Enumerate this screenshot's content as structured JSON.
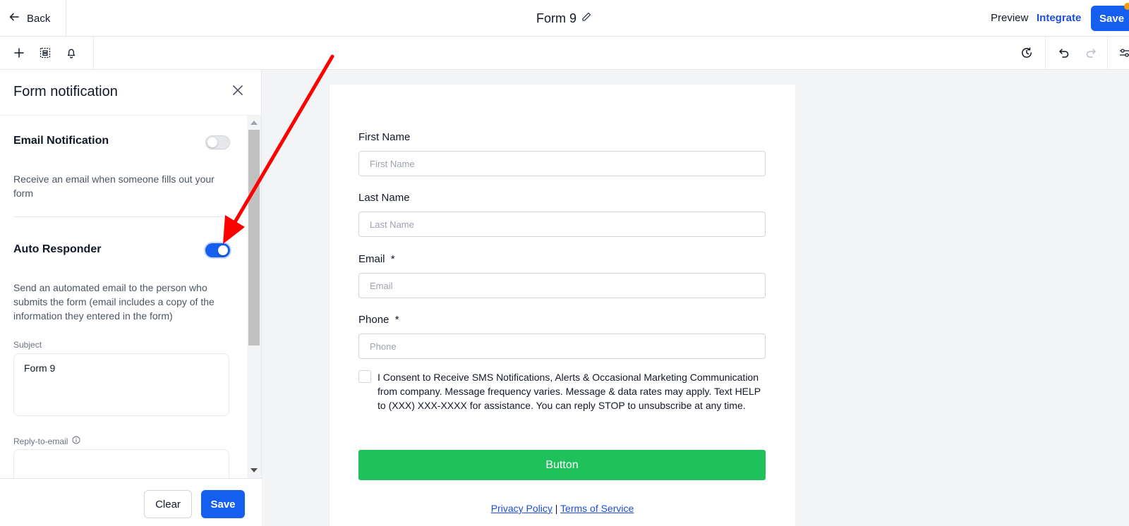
{
  "topbar": {
    "back_label": "Back",
    "form_title": "Form 9",
    "preview_label": "Preview",
    "integrate_label": "Integrate",
    "save_label": "Save"
  },
  "toolbar": {
    "left_icons": [
      "plus-icon",
      "layout-icon",
      "bell-icon"
    ],
    "right_icons": [
      "history-icon",
      "undo-icon",
      "redo-icon",
      "settings-sliders-icon"
    ]
  },
  "panel": {
    "title": "Form notification",
    "email_notification": {
      "title": "Email Notification",
      "enabled": false,
      "description": "Receive an email when someone fills out your form"
    },
    "auto_responder": {
      "title": "Auto Responder",
      "enabled": true,
      "description": "Send an automated email to the person who submits the form (email includes a copy of the information they entered in the form)"
    },
    "subject": {
      "label": "Subject",
      "value": "Form 9"
    },
    "reply_to": {
      "label": "Reply-to-email",
      "value": ""
    },
    "clear_label": "Clear",
    "save_label": "Save"
  },
  "form": {
    "fields": [
      {
        "label": "First Name",
        "placeholder": "First Name"
      },
      {
        "label": "Last Name",
        "placeholder": "Last Name"
      },
      {
        "label": "Email  *",
        "placeholder": "Email"
      },
      {
        "label": "Phone  *",
        "placeholder": "Phone"
      }
    ],
    "consent_text": "I Consent to Receive SMS Notifications, Alerts & Occasional Marketing Communication from company. Message frequency varies. Message & data rates may apply. Text HELP to (XXX) XXX-XXXX for assistance. You can reply STOP to unsubscribe at any time.",
    "button_label": "Button",
    "privacy_label": "Privacy Policy",
    "separator": "|",
    "terms_label": "Terms of Service"
  },
  "colors": {
    "primary": "#155eef",
    "submit_green": "#1ec15a",
    "annotation_arrow": "#ff0000"
  }
}
